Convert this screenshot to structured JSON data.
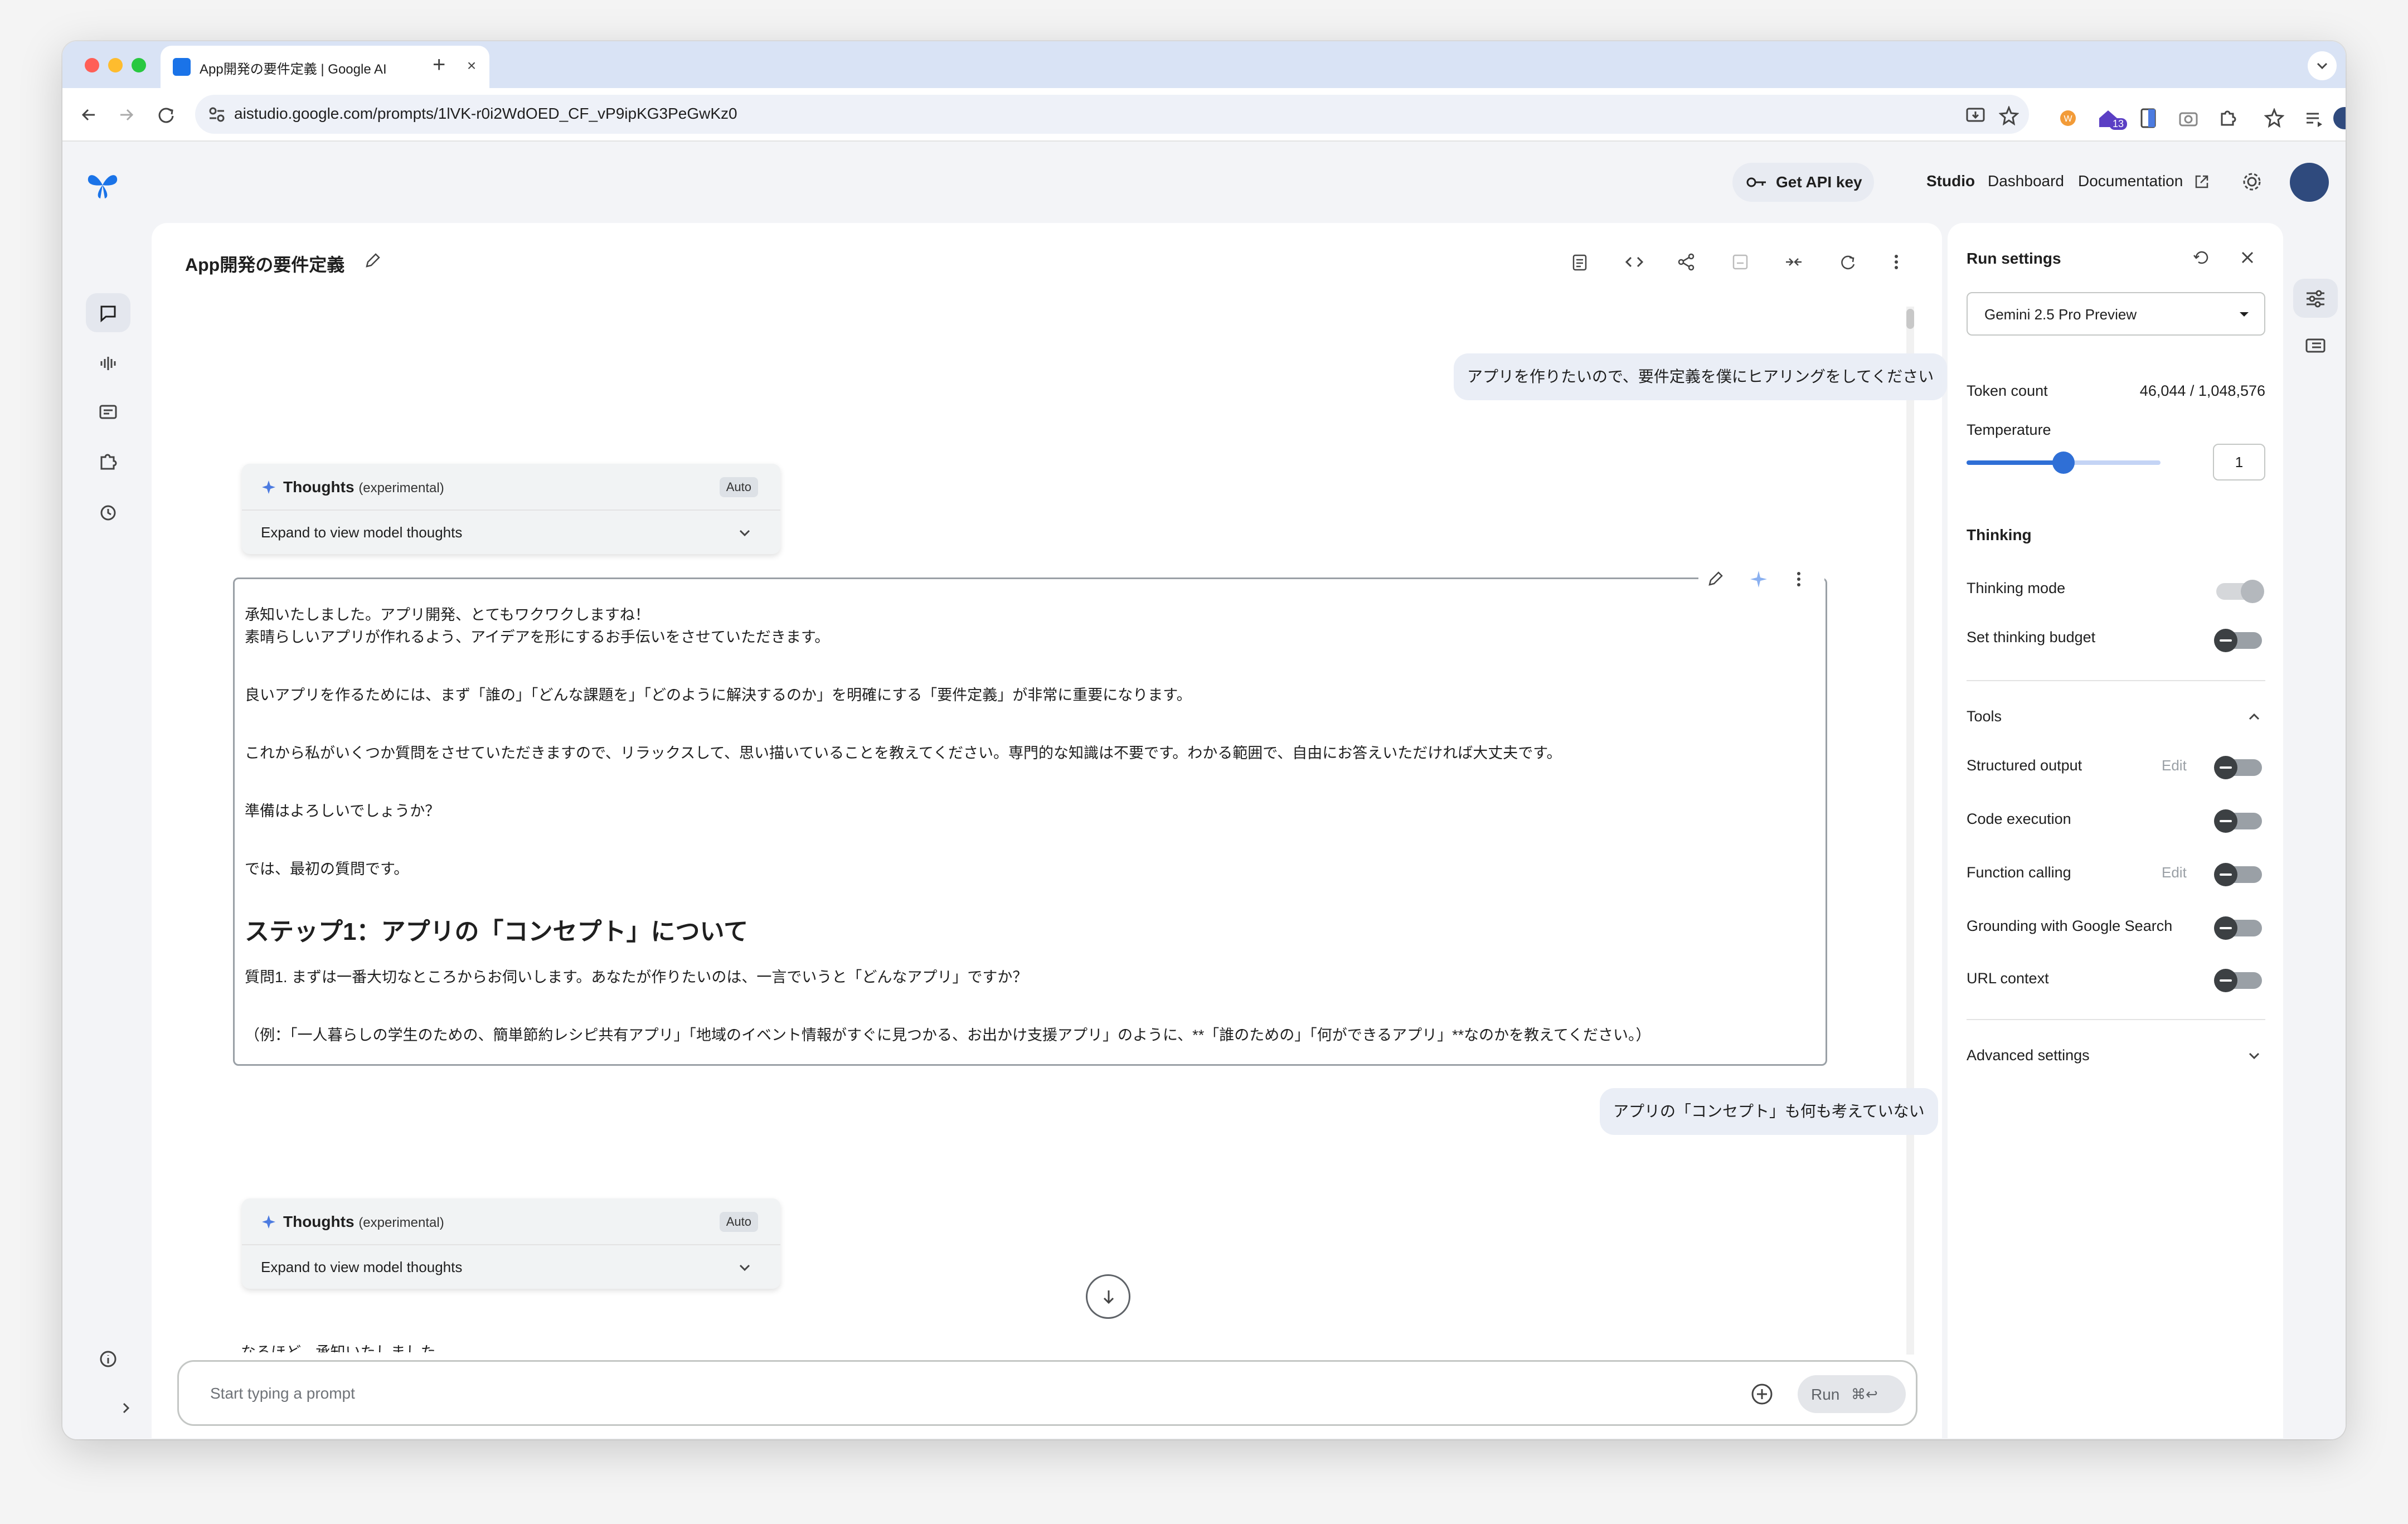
{
  "browser": {
    "tab_title": "App開発の要件定義 | Google AI",
    "url": "aistudio.google.com/prompts/1lVK-r0i2WdOED_CF_vP9ipKG3PeGwKz0",
    "extension_badge": "13"
  },
  "header": {
    "api_key_label": "Get API key",
    "nav": [
      "Studio",
      "Dashboard",
      "Documentation"
    ]
  },
  "prompt": {
    "title": "App開発の要件定義"
  },
  "chat": {
    "user_msg_1": "アプリを作りたいので、要件定義を僕にヒアリングをしてください",
    "user_msg_2": "アプリの「コンセプト」も何も考えていない",
    "thoughts_label": "Thoughts",
    "thoughts_exp": "(experimental)",
    "thoughts_auto": "Auto",
    "thoughts_expand": "Expand to view model thoughts",
    "response": {
      "line1": "承知いたしました。アプリ開発、とてもワクワクしますね！",
      "line2": "素晴らしいアプリが作れるよう、アイデアを形にするお手伝いをさせていただきます。",
      "line3": "良いアプリを作るためには、まず「誰の」「どんな課題を」「どのように解決するのか」を明確にする「要件定義」が非常に重要になります。",
      "line4": "これから私がいくつか質問をさせていただきますので、リラックスして、思い描いていることを教えてください。専門的な知識は不要です。わかる範囲で、自由にお答えいただければ大丈夫です。",
      "line5": "準備はよろしいでしょうか？",
      "line6": "では、最初の質問です。",
      "heading": "ステップ1：アプリの「コンセプト」について",
      "line7": "質問1. まずは一番大切なところからお伺いします。あなたが作りたいのは、一言でいうと「どんなアプリ」ですか？",
      "line8": "（例：「一人暮らしの学生のための、簡単節約レシピ共有アプリ」「地域のイベント情報がすぐに見つかる、お出かけ支援アプリ」のように、**「誰のための」「何ができるアプリ」**なのかを教えてください。）"
    },
    "peek_text": "なるほど、承知いたしました。",
    "input_placeholder": "Start typing a prompt",
    "run_label": "Run",
    "run_shortcut": "⌘↩"
  },
  "settings": {
    "title": "Run settings",
    "model": "Gemini 2.5 Pro Preview",
    "token_label": "Token count",
    "token_value": "46,044 / 1,048,576",
    "temperature_label": "Temperature",
    "temperature_value": "1",
    "temperature_fraction": 0.5,
    "thinking_head": "Thinking",
    "thinking_mode": "Thinking mode",
    "thinking_budget": "Set thinking budget",
    "tools_head": "Tools",
    "structured_output": "Structured output",
    "code_execution": "Code execution",
    "function_calling": "Function calling",
    "grounding": "Grounding with Google Search",
    "url_context": "URL context",
    "edit_label": "Edit",
    "advanced": "Advanced settings"
  },
  "colors": {
    "accent": "#2f6fd6",
    "tabbar": "#d9e3f5"
  }
}
